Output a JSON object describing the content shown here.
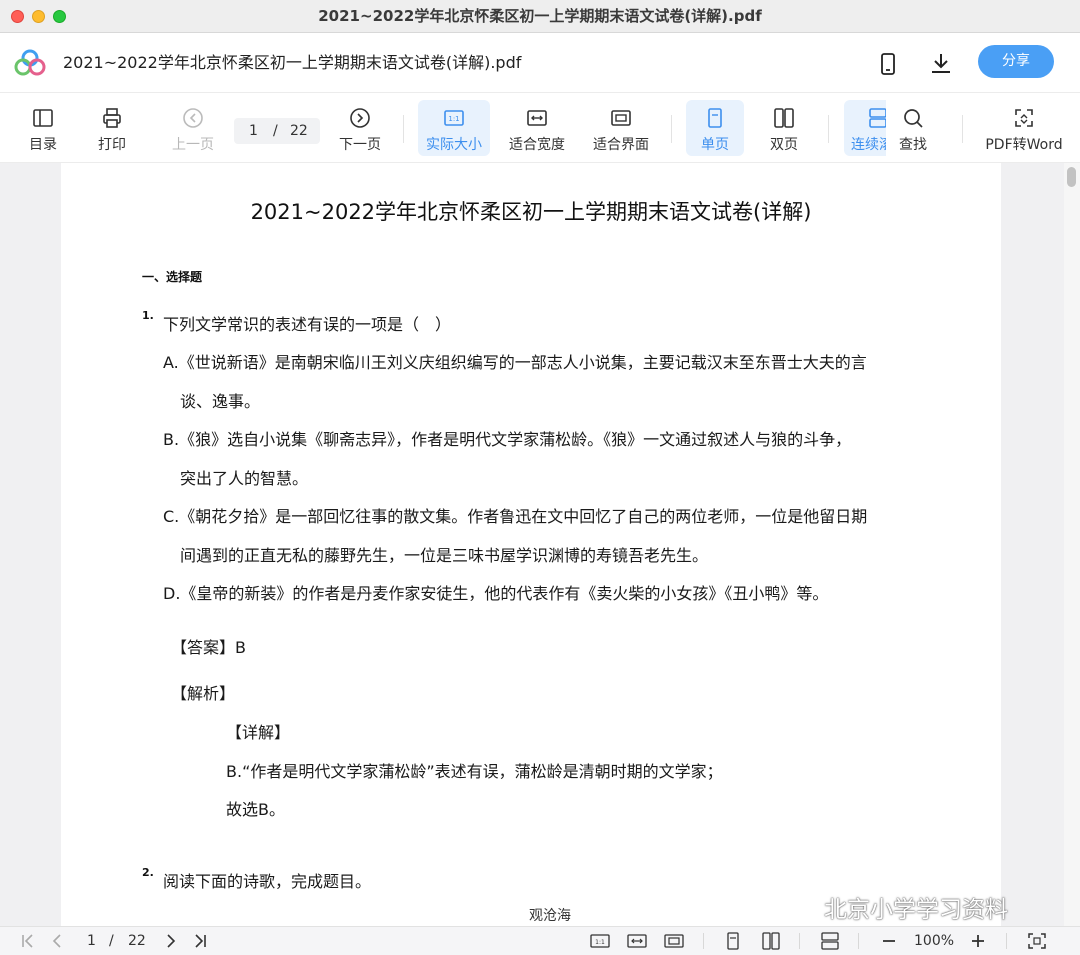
{
  "window": {
    "title": "2021~2022学年北京怀柔区初一上学期期末语文试卷(详解).pdf"
  },
  "header": {
    "doc_name": "2021~2022学年北京怀柔区初一上学期期末语文试卷(详解).pdf",
    "share_label": "分享"
  },
  "toolbar": {
    "toc": "目录",
    "print": "打印",
    "prev": "上一页",
    "page_current": "1",
    "page_sep": "/",
    "page_total": "22",
    "next": "下一页",
    "actual_size": "实际大小",
    "fit_width": "适合宽度",
    "fit_page": "适合界面",
    "single_page": "单页",
    "double_page": "双页",
    "continuous": "连续滚",
    "find": "查找",
    "pdf_to_word": "PDF转Word"
  },
  "document": {
    "title": "2021~2022学年北京怀柔区初一上学期期末语文试卷(详解)",
    "section": "一、选择题",
    "q1": {
      "num": "1.",
      "stem": "下列文学常识的表述有误的一项是（　）",
      "a1": "A.《世说新语》是南朝宋临川王刘义庆组织编写的一部志人小说集，主要记载汉末至东晋士大夫的言",
      "a2": "谈、逸事。",
      "b1": "B.《狼》选自小说集《聊斋志异》，作者是明代文学家蒲松龄。《狼》一文通过叙述人与狼的斗争，",
      "b2": "突出了人的智慧。",
      "c1": "C.《朝花夕拾》是一部回忆往事的散文集。作者鲁迅在文中回忆了自己的两位老师，一位是他留日期",
      "c2": "间遇到的正直无私的藤野先生，一位是三味书屋学识渊博的寿镜吾老先生。",
      "d1": "D.《皇帝的新装》的作者是丹麦作家安徒生，他的代表作有《卖火柴的小女孩》《丑小鸭》等。",
      "answer": "【答案】B",
      "analysis": "【解析】",
      "detail": "【详解】",
      "detail_text": "B.“作者是明代文学家蒲松龄”表述有误，蒲松龄是清朝时期的文学家；",
      "conclusion": "故选B。"
    },
    "q2": {
      "num": "2.",
      "stem": "阅读下面的诗歌，完成题目。",
      "poem_title": "观沧海"
    }
  },
  "watermark": {
    "text": "北京小学学习资料"
  },
  "statusbar": {
    "page_current": "1",
    "page_sep": "/",
    "page_total": "22",
    "zoom": "100%"
  },
  "colors": {
    "accent": "#4a9ff5",
    "active_bg": "#e8f2fd",
    "active_text": "#3d8fee"
  }
}
